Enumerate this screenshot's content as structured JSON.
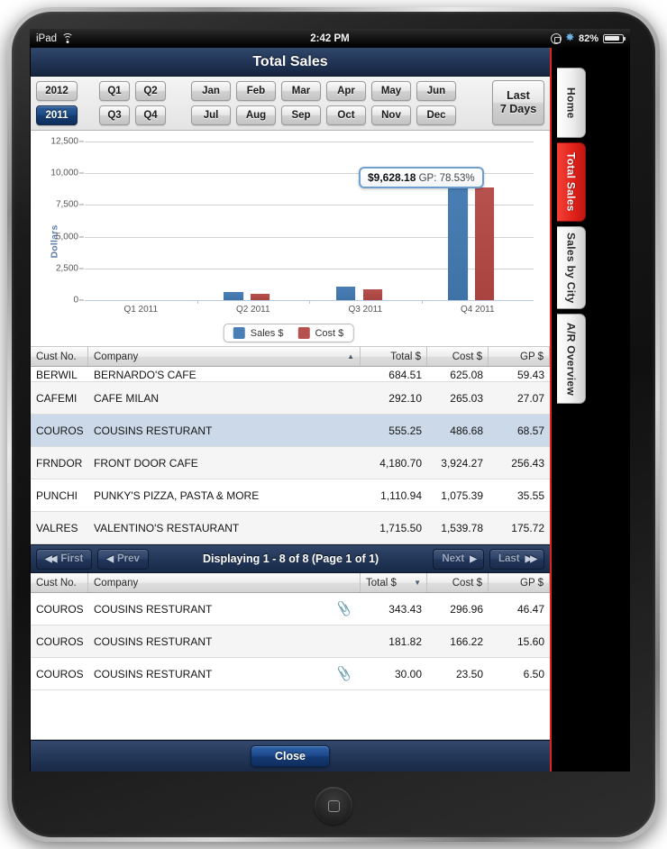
{
  "status_bar": {
    "device": "iPad",
    "wifi_icon": "wifi-icon",
    "time": "2:42 PM",
    "rotation_lock_icon": "rotation-lock-icon",
    "bluetooth_icon": "bluetooth-icon",
    "battery_percent": "82%",
    "battery_icon": "battery-icon"
  },
  "header": {
    "title": "Total Sales"
  },
  "filters": {
    "years": [
      {
        "label": "2012",
        "active": false
      },
      {
        "label": "2011",
        "active": true
      }
    ],
    "quarters_row1": [
      {
        "label": "Q1",
        "active": false
      },
      {
        "label": "Q2",
        "active": false
      }
    ],
    "quarters_row2": [
      {
        "label": "Q3",
        "active": false
      },
      {
        "label": "Q4",
        "active": false
      }
    ],
    "months_row1": [
      "Jan",
      "Feb",
      "Mar",
      "Apr",
      "May",
      "Jun"
    ],
    "months_row2": [
      "Jul",
      "Aug",
      "Sep",
      "Oct",
      "Nov",
      "Dec"
    ],
    "last_days": {
      "line1": "Last",
      "line2": "7 Days"
    }
  },
  "chart_data": {
    "type": "bar",
    "title": "",
    "xlabel": "",
    "ylabel": "Dollars",
    "categories": [
      "Q1 2011",
      "Q2 2011",
      "Q3 2011",
      "Q4 2011"
    ],
    "series": [
      {
        "name": "Sales $",
        "color": "#4a7fb5",
        "values": [
          0,
          640,
          1040,
          9628.18
        ]
      },
      {
        "name": "Cost $",
        "color": "#b7514e",
        "values": [
          0,
          510,
          880,
          8900
        ]
      }
    ],
    "ylim": [
      0,
      12500
    ],
    "yticks": [
      0,
      2500,
      5000,
      7500,
      10000,
      12500
    ],
    "ytick_labels": [
      "0",
      "2,500",
      "5,000",
      "7,500",
      "10,000",
      "12,500"
    ],
    "grid": true,
    "legend_position": "bottom",
    "annotation": {
      "value": "$9,628.18",
      "detail": "GP: 78.53%",
      "target_category": "Q4 2011",
      "target_series": "Sales $"
    }
  },
  "summary_grid": {
    "columns": [
      {
        "key": "cust",
        "label": "Cust No.",
        "align": "left",
        "sorted": false,
        "sort_dir": ""
      },
      {
        "key": "comp",
        "label": "Company",
        "align": "left",
        "sorted": true,
        "sort_dir": "asc"
      },
      {
        "key": "tot",
        "label": "Total $",
        "align": "right",
        "sorted": false,
        "sort_dir": ""
      },
      {
        "key": "cost",
        "label": "Cost $",
        "align": "right",
        "sorted": false,
        "sort_dir": ""
      },
      {
        "key": "gp",
        "label": "GP $",
        "align": "right",
        "sorted": false,
        "sort_dir": ""
      }
    ],
    "rows": [
      {
        "cust": "BERWIL",
        "comp": "BERNARDO'S CAFE",
        "tot": "684.51",
        "cost": "625.08",
        "gp": "59.43",
        "state": "clipped"
      },
      {
        "cust": "CAFEMI",
        "comp": "CAFE MILAN",
        "tot": "292.10",
        "cost": "265.03",
        "gp": "27.07",
        "state": "alt"
      },
      {
        "cust": "COUROS",
        "comp": "COUSINS RESTURANT",
        "tot": "555.25",
        "cost": "486.68",
        "gp": "68.57",
        "state": "selected"
      },
      {
        "cust": "FRNDOR",
        "comp": "FRONT DOOR CAFE",
        "tot": "4,180.70",
        "cost": "3,924.27",
        "gp": "256.43",
        "state": "alt"
      },
      {
        "cust": "PUNCHI",
        "comp": "PUNKY'S PIZZA, PASTA & MORE",
        "tot": "1,110.94",
        "cost": "1,075.39",
        "gp": "35.55",
        "state": "normal"
      },
      {
        "cust": "VALRES",
        "comp": "VALENTINO'S RESTAURANT",
        "tot": "1,715.50",
        "cost": "1,539.78",
        "gp": "175.72",
        "state": "alt"
      }
    ]
  },
  "pager": {
    "first_label": "First",
    "prev_label": "Prev",
    "status": "Displaying 1 - 8 of 8 (Page 1 of 1)",
    "next_label": "Next",
    "last_label": "Last"
  },
  "detail_grid": {
    "columns": [
      {
        "key": "cust",
        "label": "Cust No.",
        "align": "left",
        "sorted": false,
        "sort_dir": ""
      },
      {
        "key": "comp",
        "label": "Company",
        "align": "left",
        "sorted": false,
        "sort_dir": ""
      },
      {
        "key": "tot",
        "label": "Total $",
        "align": "right",
        "sorted": true,
        "sort_dir": "desc"
      },
      {
        "key": "cost",
        "label": "Cost $",
        "align": "right",
        "sorted": false,
        "sort_dir": ""
      },
      {
        "key": "gp",
        "label": "GP $",
        "align": "right",
        "sorted": false,
        "sort_dir": ""
      }
    ],
    "rows": [
      {
        "cust": "COUROS",
        "comp": "COUSINS RESTURANT",
        "attachment": true,
        "tot": "343.43",
        "cost": "296.96",
        "gp": "46.47",
        "state": "normal"
      },
      {
        "cust": "COUROS",
        "comp": "COUSINS RESTURANT",
        "attachment": false,
        "tot": "181.82",
        "cost": "166.22",
        "gp": "15.60",
        "state": "alt"
      },
      {
        "cust": "COUROS",
        "comp": "COUSINS RESTURANT",
        "attachment": true,
        "tot": "30.00",
        "cost": "23.50",
        "gp": "6.50",
        "state": "normal"
      }
    ]
  },
  "footer": {
    "close_label": "Close"
  },
  "side_tabs": [
    {
      "label": "Home",
      "active": false
    },
    {
      "label": "Total Sales",
      "active": true
    },
    {
      "label": "Sales by City",
      "active": false
    },
    {
      "label": "A/R Overview",
      "active": false
    }
  ],
  "colors": {
    "accent_red": "#e2231a",
    "sales_blue": "#4a7fb5",
    "cost_red": "#b7514e",
    "chrome_navy": "#24385a"
  }
}
